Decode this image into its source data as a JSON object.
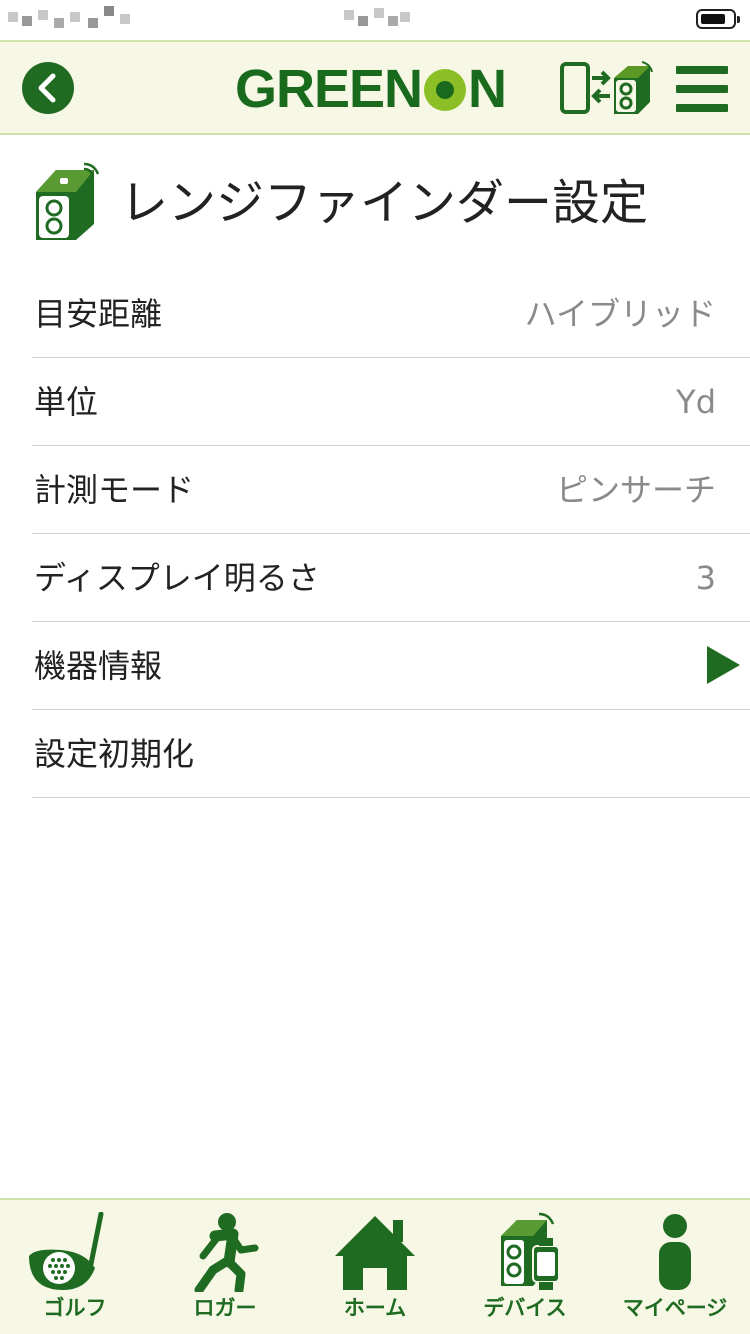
{
  "nav": {
    "brand": "GREENON"
  },
  "page": {
    "title": "レンジファインダー設定"
  },
  "settings": [
    {
      "label": "目安距離",
      "value": "ハイブリッド"
    },
    {
      "label": "単位",
      "value": "Yd"
    },
    {
      "label": "計測モード",
      "value": "ピンサーチ"
    },
    {
      "label": "ディスプレイ明るさ",
      "value": "3"
    },
    {
      "label": "機器情報",
      "value": ""
    },
    {
      "label": "設定初期化",
      "value": ""
    }
  ],
  "tabs": [
    {
      "label": "ゴルフ",
      "icon": "golf-club-icon"
    },
    {
      "label": "ロガー",
      "icon": "runner-icon"
    },
    {
      "label": "ホーム",
      "icon": "home-icon"
    },
    {
      "label": "デバイス",
      "icon": "device-icon"
    },
    {
      "label": "マイページ",
      "icon": "person-icon"
    }
  ],
  "colors": {
    "brand_green": "#1f6b22",
    "accent_lime": "#8cbf26",
    "bar_background": "#f6f7e4"
  }
}
